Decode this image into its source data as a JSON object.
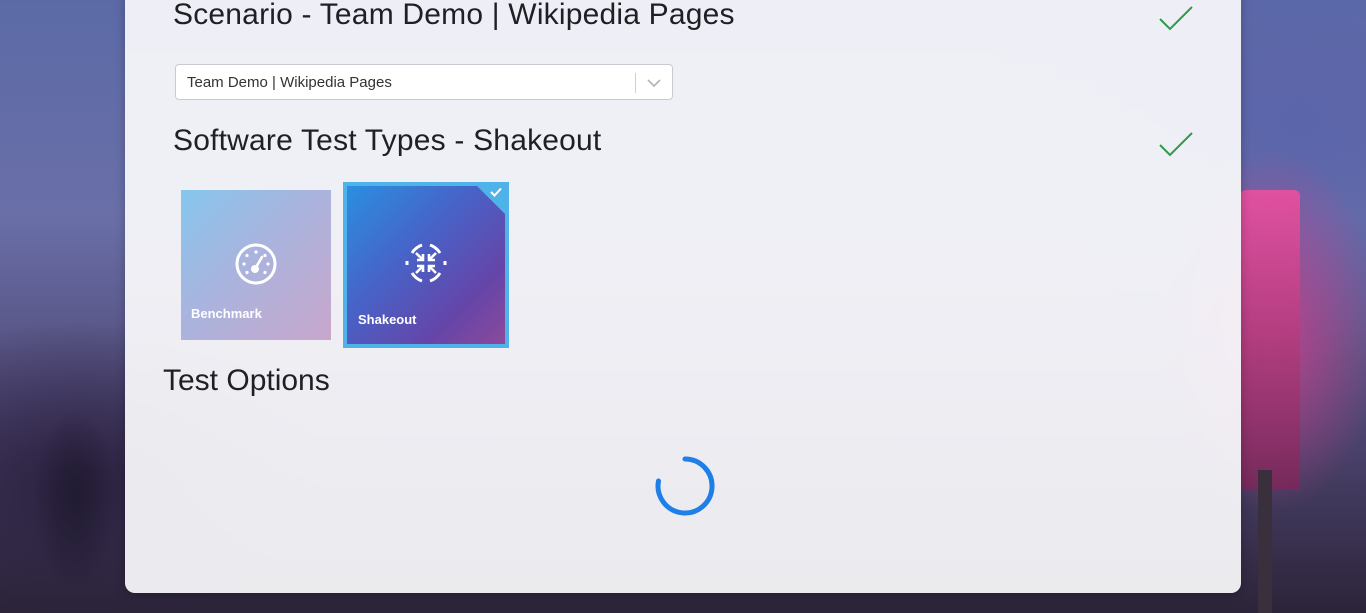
{
  "scenario": {
    "title": "Scenario - Team Demo | Wikipedia Pages",
    "completed_icon": "checkmark-icon",
    "select": {
      "value": "Team Demo | Wikipedia Pages",
      "arrow_icon": "chevron-down-icon"
    }
  },
  "test_types": {
    "title": "Software Test Types - Shakeout",
    "completed_icon": "checkmark-icon",
    "tiles": [
      {
        "label": "Benchmark",
        "icon": "speedometer-icon",
        "selected": false
      },
      {
        "label": "Shakeout",
        "icon": "shake-arrows-icon",
        "selected": true
      }
    ]
  },
  "test_options": {
    "title": "Test Options",
    "loading_icon": "loading-spinner-icon"
  },
  "colors": {
    "accent": "#4fb3ea",
    "check_green": "#2e9a4a",
    "spinner_blue": "#1e7fe6"
  }
}
